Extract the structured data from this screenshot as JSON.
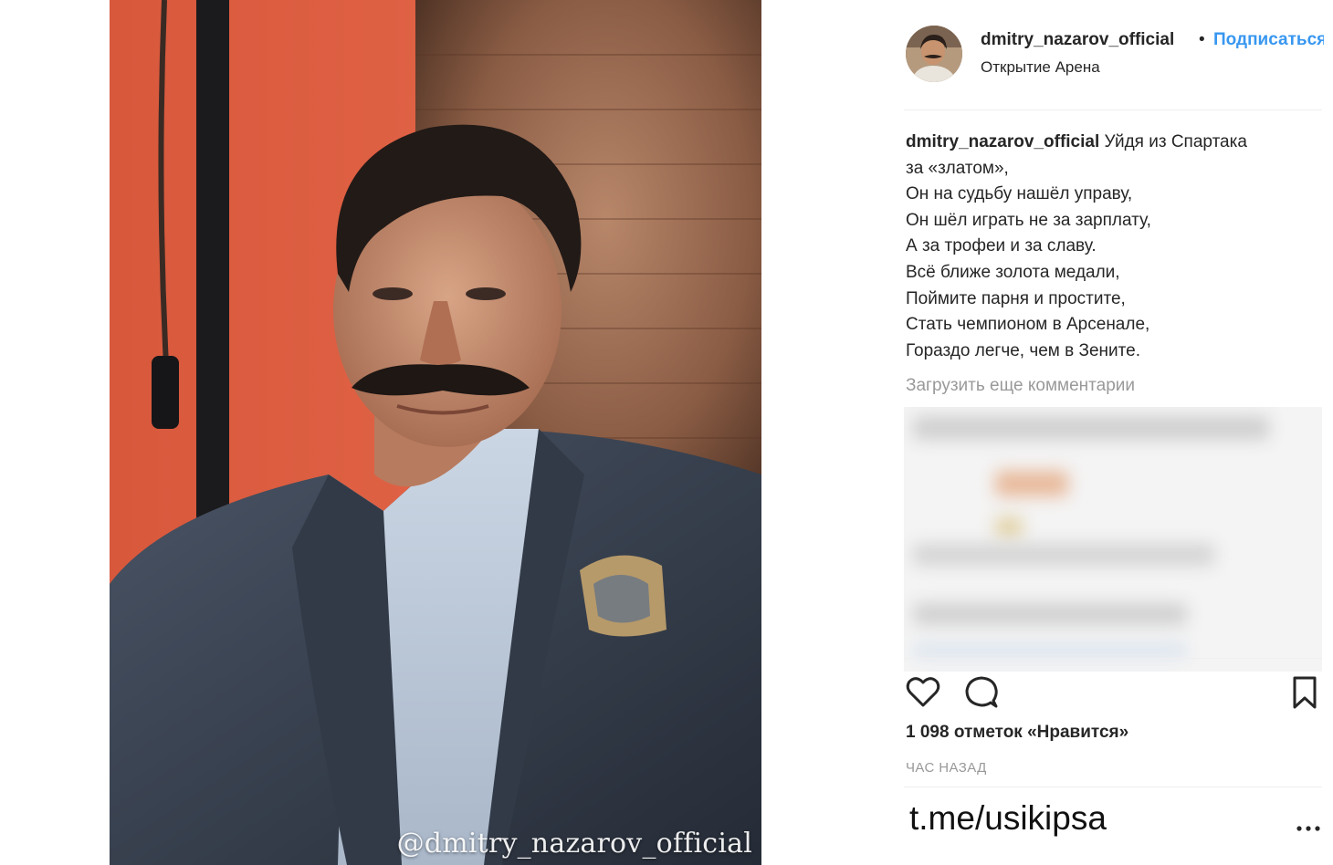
{
  "post": {
    "username": "dmitry_nazarov_official",
    "separator": "•",
    "follow_label": "Подписаться",
    "location": "Открытие Арена",
    "watermark": "@dmitry_nazarov_official"
  },
  "caption": {
    "username": "dmitry_nazarov_official",
    "lines": [
      "Уйдя из Спартака",
      "за «златом»,",
      "Он на судьбу нашёл управу,",
      "Он шёл играть не за зарплату,",
      "А за трофеи и за славу.",
      "Всё ближе золота медали,",
      "Поймите парня и простите,",
      "Стать чемпионом в Арсенале,",
      "Гораздо легче, чем в Зените."
    ]
  },
  "comments": {
    "load_more_label": "Загрузить еще комментарии"
  },
  "actions": {
    "like_icon": "heart-icon",
    "comment_icon": "comment-icon",
    "save_icon": "bookmark-icon",
    "more_icon": "more-dots-icon"
  },
  "stats": {
    "likes_text": "1 098 отметок «Нравится»",
    "time_text": "ЧАС НАЗАД"
  },
  "footer": {
    "text": "t.me/usikipsa"
  },
  "colors": {
    "link_blue": "#3897f0",
    "muted_gray": "#999999",
    "text": "#262626"
  }
}
